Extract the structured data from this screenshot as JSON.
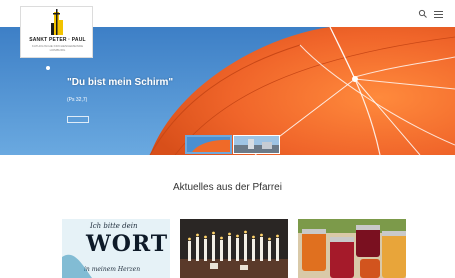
{
  "brand": {
    "name": "SANKT PETER · PAUL",
    "subtitle": "KATHOLISCHE KIRCHENGEMEINDE HOMBURG"
  },
  "header": {
    "search_icon": "search-icon",
    "menu_icon": "menu-icon"
  },
  "hero": {
    "title": "\"Du bist mein Schirm\"",
    "reference": "(Ps 32,7)",
    "button_label": "",
    "colors": {
      "umbrella": "#f06a28",
      "sky": "#4a8fd0"
    }
  },
  "news": {
    "heading": "Aktuelles aus der Pfarrei",
    "cards": [
      {
        "line1": "Ich bitte dein",
        "word": "WORT",
        "line3": "in meinem Herzen"
      },
      {
        "image": "candles"
      },
      {
        "image": "jam-jars"
      }
    ]
  }
}
